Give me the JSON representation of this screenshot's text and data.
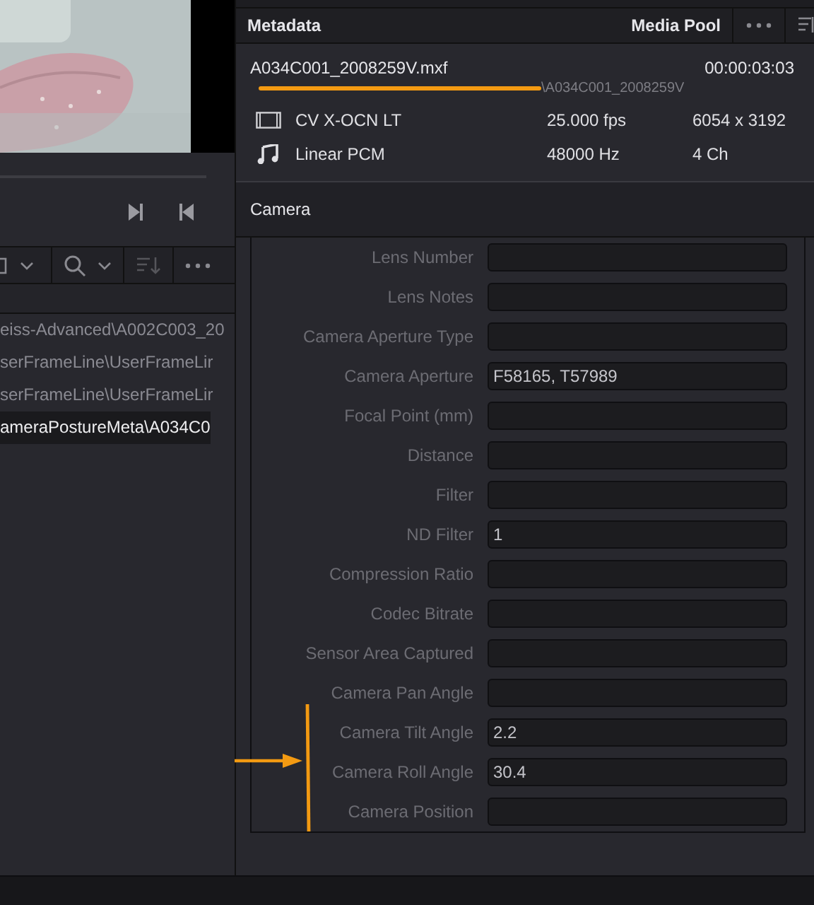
{
  "media_list": {
    "rows": [
      {
        "path": "eiss-Advanced\\A002C003_20",
        "selected": false
      },
      {
        "path": "serFrameLine\\UserFrameLir",
        "selected": false
      },
      {
        "path": "serFrameLine\\UserFrameLir",
        "selected": false
      },
      {
        "path": "ameraPostureMeta\\A034C0",
        "selected": true
      }
    ]
  },
  "metadata": {
    "title": "Metadata",
    "tab": "Media Pool",
    "clip": {
      "filename": "A034C001_2008259V.mxf",
      "timecode": "00:00:03:03",
      "path": "\\A034C001_2008259V",
      "video": {
        "codec": "CV X-OCN LT",
        "rate": "25.000 fps",
        "resolution": "6054 x 3192"
      },
      "audio": {
        "codec": "Linear PCM",
        "rate": "48000 Hz",
        "channels": "4 Ch"
      }
    },
    "section": "Camera",
    "fields": [
      {
        "label": "Lens Number"
      },
      {
        "label": "Lens Notes"
      },
      {
        "label": "Camera Aperture Type"
      },
      {
        "label": "Camera Aperture",
        "value": "F58165, T57989"
      },
      {
        "label": "Focal Point (mm)"
      },
      {
        "label": "Distance"
      },
      {
        "label": "Filter"
      },
      {
        "label": "ND Filter",
        "value": "1"
      },
      {
        "label": "Compression Ratio"
      },
      {
        "label": "Codec Bitrate"
      },
      {
        "label": "Sensor Area Captured"
      },
      {
        "label": "Camera Pan Angle"
      },
      {
        "label": "Camera Tilt Angle",
        "value": "2.2"
      },
      {
        "label": "Camera Roll Angle",
        "value": "30.4"
      },
      {
        "label": "Camera Position"
      }
    ]
  }
}
